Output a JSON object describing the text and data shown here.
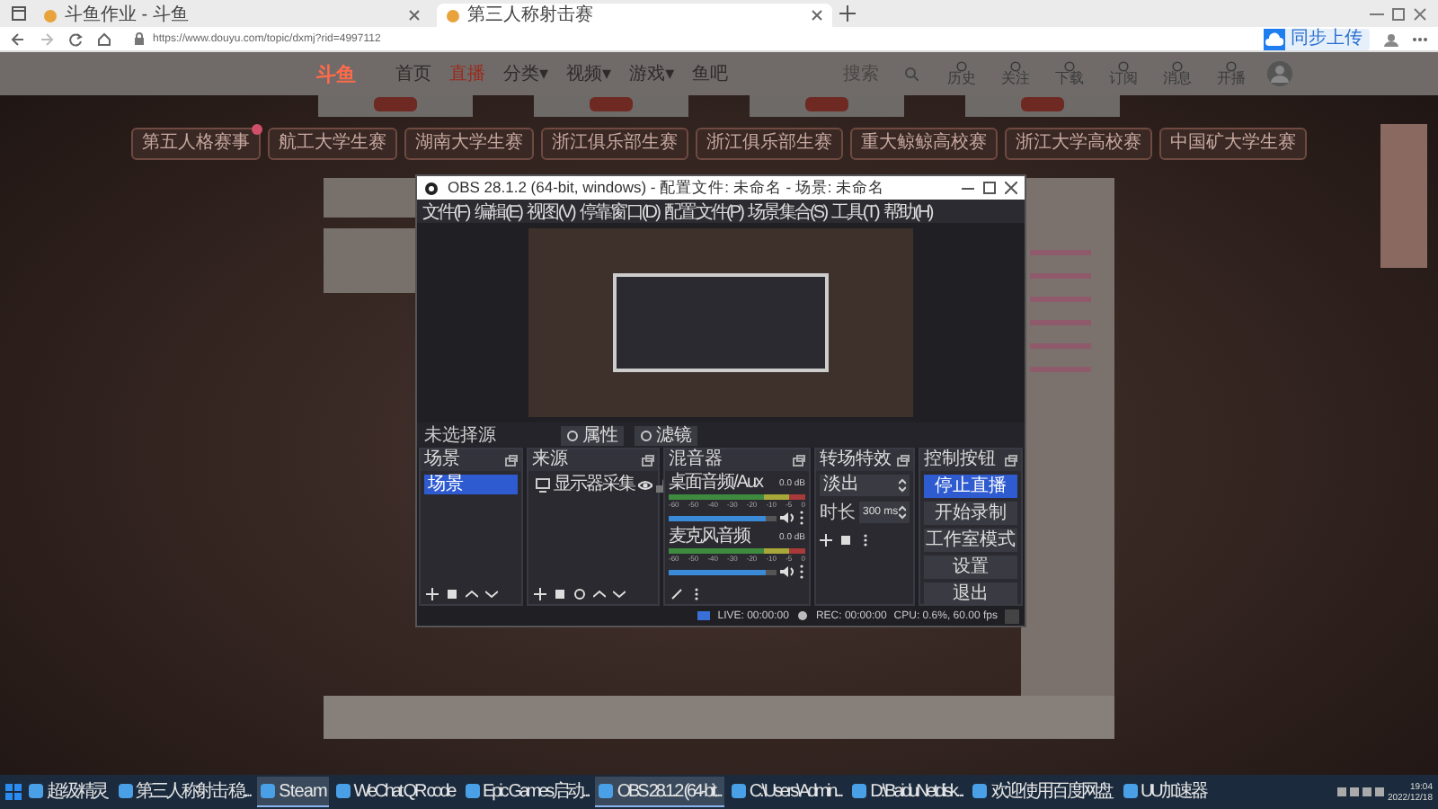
{
  "browser": {
    "tabs": [
      {
        "title": "斗鱼作业 - 斗鱼",
        "selected": false
      },
      {
        "title": "第三人称射击赛",
        "selected": true
      }
    ],
    "url": "https://www.douyu.com/topic/dxmj?rid=4997112",
    "cloud_button": "同步上传"
  },
  "site": {
    "logo": "斗鱼",
    "nav": [
      {
        "label": "首页",
        "selected": false
      },
      {
        "label": "直播",
        "selected": true
      },
      {
        "label": "分类▾",
        "selected": false
      },
      {
        "label": "视频▾",
        "selected": false
      },
      {
        "label": "游戏▾",
        "selected": false
      },
      {
        "label": "鱼吧",
        "selected": false
      }
    ],
    "search_placeholder": "搜索",
    "toolbar": [
      "历史",
      "关注",
      "下载",
      "订阅",
      "消息",
      "开播"
    ]
  },
  "categories": [
    {
      "label": "第五人格赛事",
      "badge": true
    },
    {
      "label": "航工大学生赛"
    },
    {
      "label": "湖南大学生赛"
    },
    {
      "label": "浙江俱乐部生赛"
    },
    {
      "label": "浙江俱乐部生赛"
    },
    {
      "label": "重大鲸鲸高校赛"
    },
    {
      "label": "浙江大学高校赛"
    },
    {
      "label": "中国矿大学生赛"
    }
  ],
  "obs": {
    "title": "OBS 28.1.2 (64-bit, windows) - 配置文件: 未命名 - 场景: 未命名",
    "menu": [
      "文件(F)",
      "编辑(E)",
      "视图(V)",
      "停靠窗口(D)",
      "配置文件(P)",
      "场景集合(S)",
      "工具(T)",
      "帮助(H)"
    ],
    "source_bar": {
      "label": "未选择源",
      "buttons": [
        "属性",
        "滤镜"
      ]
    },
    "scenes": {
      "title": "场景",
      "items": [
        {
          "name": "场景",
          "selected": true
        }
      ]
    },
    "sources": {
      "title": "来源",
      "items": [
        {
          "name": "显示器采集",
          "visible": true,
          "locked": false
        }
      ]
    },
    "mixer": {
      "title": "混音器",
      "channels": [
        {
          "name": "桌面音频/Aux",
          "reading": "0.0 dB",
          "scale": [
            "-60",
            "-50",
            "-40",
            "-30",
            "-20",
            "-10",
            "-5",
            "0"
          ],
          "level": 0.9,
          "muted": false
        },
        {
          "name": "麦克风音频",
          "reading": "0.0 dB",
          "scale": [
            "-60",
            "-50",
            "-40",
            "-30",
            "-20",
            "-10",
            "-5",
            "0"
          ],
          "level": 0.9,
          "muted": false
        }
      ]
    },
    "transitions": {
      "title": "转场特效",
      "type": "淡出",
      "duration_label": "时长",
      "duration": "300 ms"
    },
    "controls": {
      "title": "控制按钮",
      "buttons": [
        {
          "label": "停止直播",
          "active": true
        },
        {
          "label": "开始录制",
          "active": false
        },
        {
          "label": "工作室模式",
          "active": false
        },
        {
          "label": "设置",
          "active": false
        },
        {
          "label": "退出",
          "active": false
        }
      ]
    },
    "status": {
      "live": "LIVE: 00:00:00",
      "rec": "REC: 00:00:00",
      "cpu": "CPU: 0.6%, 60.00 fps"
    }
  },
  "taskbar": {
    "items": [
      {
        "label": "超级精灵",
        "active": false
      },
      {
        "label": "第三人称射击 稳...",
        "active": false
      },
      {
        "label": "S t e a m",
        "active": true
      },
      {
        "label": "WeChat QR code",
        "active": false
      },
      {
        "label": "Epic Games启动...",
        "active": false
      },
      {
        "label": "OBS 28.1.2 (64-bit...",
        "active": true
      },
      {
        "label": "C:\\Users\\Admin...",
        "active": false
      },
      {
        "label": "D:\\BaiduNetdisk...",
        "active": false
      },
      {
        "label": "欢迎使用百度网盘",
        "active": false
      },
      {
        "label": "UU加速器",
        "active": false
      }
    ],
    "time": "19:04",
    "date": "2022/12/18"
  }
}
